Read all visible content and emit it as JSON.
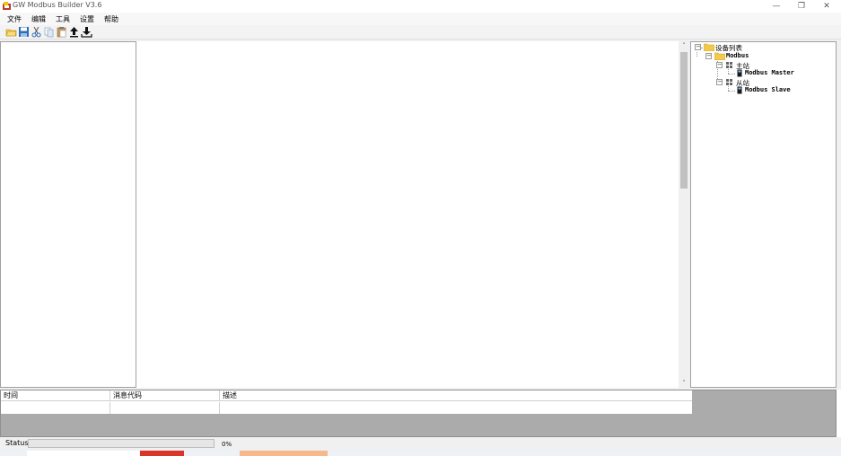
{
  "window": {
    "title": "GW Modbus Builder V3.6",
    "minimize": "—",
    "restore": "❐",
    "close": "✕"
  },
  "menu": {
    "items": [
      "文件",
      "编辑",
      "工具",
      "设置",
      "帮助"
    ]
  },
  "toolbar": {
    "buttons": [
      "open-folder-icon",
      "save-icon",
      "cut-icon",
      "copy-icon",
      "paste-icon",
      "upload-icon",
      "download-icon"
    ]
  },
  "device_tree": {
    "root": "设备列表",
    "modbus": "Modbus",
    "master_group": "主站",
    "master_item": "Modbus Master",
    "slave_group": "从站",
    "slave_item": "Modbus Slave"
  },
  "scrollbar": {
    "up": "˄",
    "down": "˅"
  },
  "log": {
    "columns": [
      "时间",
      "消息代码",
      "描述"
    ]
  },
  "status": {
    "label": "Status",
    "progress_percent": 0,
    "progress_text": "0%"
  },
  "colors": {
    "progress": "#06b025",
    "folder": "#f4c84a",
    "taskbar_red": "#d9352b",
    "taskbar_orange": "#f7b98a"
  }
}
